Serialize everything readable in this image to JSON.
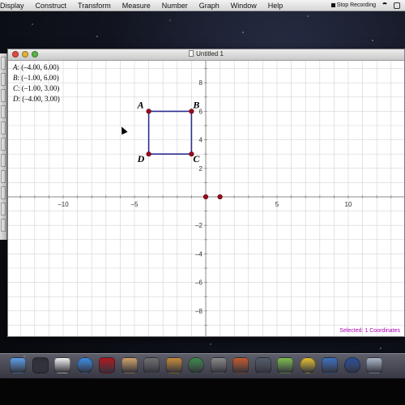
{
  "menubar": {
    "items": [
      "Display",
      "Construct",
      "Transform",
      "Measure",
      "Number",
      "Graph",
      "Window",
      "Help"
    ],
    "recording_label": "Stop Recording"
  },
  "window": {
    "title": "Untitled 1"
  },
  "canvas": {
    "points_text": [
      {
        "letter": "A",
        "coords": ": (–4.00, 6.00)"
      },
      {
        "letter": "B",
        "coords": ": (–1.00, 6.00)"
      },
      {
        "letter": "C",
        "coords": ": (–1.00, 3.00)"
      },
      {
        "letter": "D",
        "coords": ": (–4.00, 3.00)"
      }
    ],
    "point_labels": [
      "A",
      "B",
      "C",
      "D"
    ],
    "points": [
      {
        "name": "A",
        "x": -4,
        "y": 6
      },
      {
        "name": "B",
        "x": -1,
        "y": 6
      },
      {
        "name": "C",
        "x": -1,
        "y": 3
      },
      {
        "name": "D",
        "x": -4,
        "y": 3
      }
    ],
    "unit_points": [
      {
        "x": 0,
        "y": 0
      },
      {
        "x": 1,
        "y": 0
      }
    ],
    "x_tick_labels": [
      "–10",
      "–5",
      "5",
      "10"
    ],
    "x_tick_values": [
      -10,
      -5,
      5,
      10
    ],
    "y_tick_labels": [
      "8",
      "6",
      "4",
      "2",
      "–2",
      "–4",
      "–6",
      "–8"
    ],
    "y_tick_values": [
      8,
      6,
      4,
      2,
      -2,
      -4,
      -6,
      -8
    ],
    "status": "Selected: 1 Coordinates",
    "colors": {
      "grid": "#d3d3d3",
      "axis": "#8a8a8a",
      "square": "#2b2f8f",
      "point": "#9b0a1e",
      "status": "#b000b8"
    }
  },
  "dock": {
    "icons": [
      {
        "name": "finder-icon",
        "color": "#5c9ee6"
      },
      {
        "name": "dashboard-icon",
        "color": "#2d2d36"
      },
      {
        "name": "calendar-icon",
        "color": "#f2f2f2"
      },
      {
        "name": "itunes-icon",
        "color": "#3a8ee8"
      },
      {
        "name": "photo-booth-icon",
        "color": "#b0161e"
      },
      {
        "name": "iphoto-icon",
        "color": "#cfa36a"
      },
      {
        "name": "system-tool-icon",
        "color": "#6f6f6f"
      },
      {
        "name": "garageband-icon",
        "color": "#c78a3b"
      },
      {
        "name": "time-machine-icon",
        "color": "#3f8a4a"
      },
      {
        "name": "screen-capture-icon",
        "color": "#888888"
      },
      {
        "name": "preview-icon",
        "color": "#c45a2c"
      },
      {
        "name": "script-editor-icon",
        "color": "#555b6a"
      },
      {
        "name": "chart-app-icon",
        "color": "#7dbd4e"
      },
      {
        "name": "chrome-icon",
        "color": "#e8c232"
      },
      {
        "name": "tools-icon",
        "color": "#3c6fbf"
      },
      {
        "name": "quicktime-icon",
        "color": "#2a4f9a"
      },
      {
        "name": "folder-icon",
        "color": "#a9b7c9"
      }
    ]
  }
}
